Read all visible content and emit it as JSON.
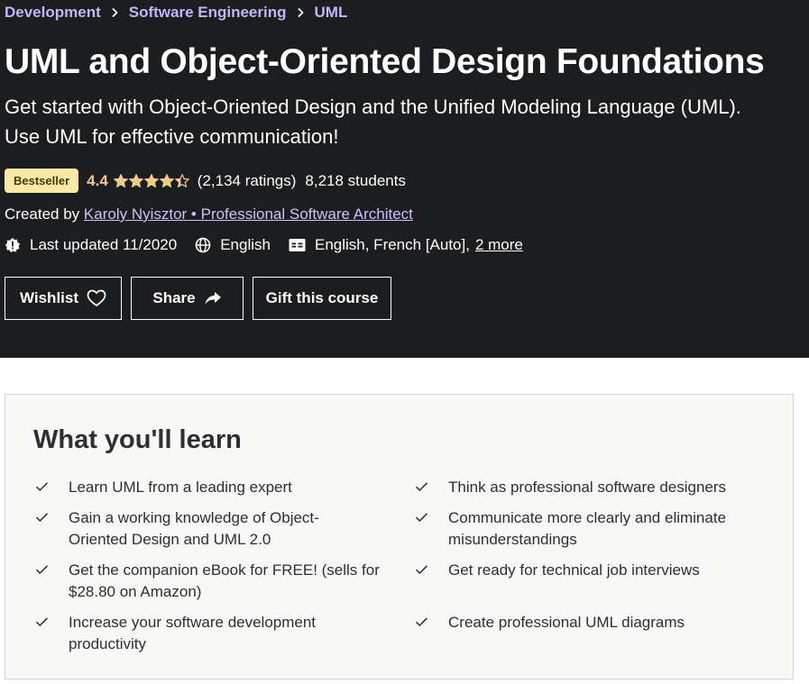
{
  "breadcrumb": [
    "Development",
    "Software Engineering",
    "UML"
  ],
  "course": {
    "title": "UML and Object-Oriented Design Foundations",
    "subtitle": "Get started with Object-Oriented Design and the Unified Modeling Language (UML). Use UML for effective communication!",
    "badge": "Bestseller",
    "rating": "4.4",
    "rating_value": 4.4,
    "ratings_count": "(2,134 ratings)",
    "students": "8,218 students",
    "created_by_label": "Created by",
    "instructor": "Karoly Nyisztor • Professional Software Architect",
    "last_updated": "Last updated 11/2020",
    "language": "English",
    "captions": "English, French [Auto],",
    "captions_more": "2 more"
  },
  "actions": {
    "wishlist": "Wishlist",
    "share": "Share",
    "gift": "Gift this course"
  },
  "learn": {
    "title": "What you'll learn",
    "left": [
      {
        "text": "Learn UML from a leading expert"
      },
      {
        "text": "Gain a working knowledge of Object-\nOriented Design and UML 2.0"
      },
      {
        "text": "Get the companion eBook for FREE! (sells for\n$28.80 on Amazon)"
      },
      {
        "text": "Increase your software development\nproductivity"
      }
    ],
    "right": [
      {
        "text": "Think as professional software designers"
      },
      {
        "text": "Communicate more clearly and eliminate\nmisunderstandings"
      },
      {
        "text": "Get ready for technical job interviews"
      },
      {
        "text": "Create professional UML diagrams"
      }
    ]
  },
  "colors": {
    "hero_bg": "#1c1d1f",
    "link": "#cec0fc",
    "rating": "#f3ca8c",
    "badge_bg": "#fce9a6",
    "learn_bg": "#f8f8f6"
  }
}
